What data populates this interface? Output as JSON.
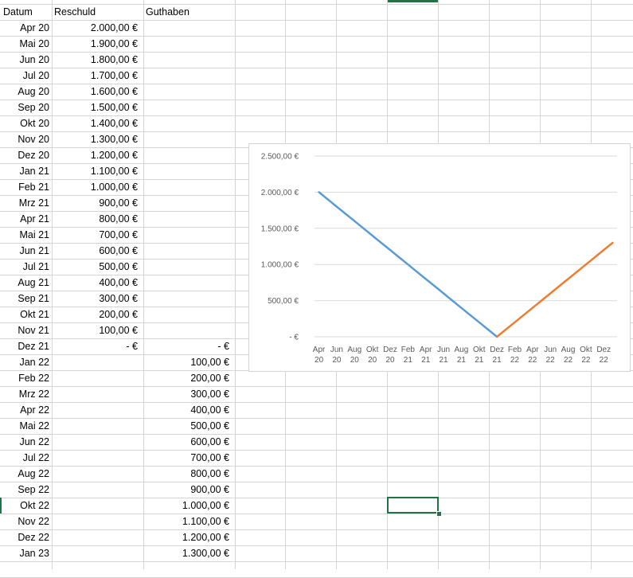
{
  "headers": {
    "datum": "Datum",
    "reschuld": "Reschuld",
    "guthaben": "Guthaben"
  },
  "rows": [
    {
      "datum": "Apr 20",
      "reschuld": "2.000,00 €",
      "guthaben": ""
    },
    {
      "datum": "Mai 20",
      "reschuld": "1.900,00 €",
      "guthaben": ""
    },
    {
      "datum": "Jun 20",
      "reschuld": "1.800,00 €",
      "guthaben": ""
    },
    {
      "datum": "Jul 20",
      "reschuld": "1.700,00 €",
      "guthaben": ""
    },
    {
      "datum": "Aug 20",
      "reschuld": "1.600,00 €",
      "guthaben": ""
    },
    {
      "datum": "Sep 20",
      "reschuld": "1.500,00 €",
      "guthaben": ""
    },
    {
      "datum": "Okt 20",
      "reschuld": "1.400,00 €",
      "guthaben": ""
    },
    {
      "datum": "Nov 20",
      "reschuld": "1.300,00 €",
      "guthaben": ""
    },
    {
      "datum": "Dez 20",
      "reschuld": "1.200,00 €",
      "guthaben": ""
    },
    {
      "datum": "Jan 21",
      "reschuld": "1.100,00 €",
      "guthaben": ""
    },
    {
      "datum": "Feb 21",
      "reschuld": "1.000,00 €",
      "guthaben": ""
    },
    {
      "datum": "Mrz 21",
      "reschuld": "900,00 €",
      "guthaben": ""
    },
    {
      "datum": "Apr 21",
      "reschuld": "800,00 €",
      "guthaben": ""
    },
    {
      "datum": "Mai 21",
      "reschuld": "700,00 €",
      "guthaben": ""
    },
    {
      "datum": "Jun 21",
      "reschuld": "600,00 €",
      "guthaben": ""
    },
    {
      "datum": "Jul 21",
      "reschuld": "500,00 €",
      "guthaben": ""
    },
    {
      "datum": "Aug 21",
      "reschuld": "400,00 €",
      "guthaben": ""
    },
    {
      "datum": "Sep 21",
      "reschuld": "300,00 €",
      "guthaben": ""
    },
    {
      "datum": "Okt 21",
      "reschuld": "200,00 €",
      "guthaben": ""
    },
    {
      "datum": "Nov 21",
      "reschuld": "100,00 €",
      "guthaben": ""
    },
    {
      "datum": "Dez 21",
      "reschuld": "-   €",
      "guthaben": "-   €"
    },
    {
      "datum": "Jan 22",
      "reschuld": "",
      "guthaben": "100,00 €"
    },
    {
      "datum": "Feb 22",
      "reschuld": "",
      "guthaben": "200,00 €"
    },
    {
      "datum": "Mrz 22",
      "reschuld": "",
      "guthaben": "300,00 €"
    },
    {
      "datum": "Apr 22",
      "reschuld": "",
      "guthaben": "400,00 €"
    },
    {
      "datum": "Mai 22",
      "reschuld": "",
      "guthaben": "500,00 €"
    },
    {
      "datum": "Jun 22",
      "reschuld": "",
      "guthaben": "600,00 €"
    },
    {
      "datum": "Jul 22",
      "reschuld": "",
      "guthaben": "700,00 €"
    },
    {
      "datum": "Aug 22",
      "reschuld": "",
      "guthaben": "800,00 €"
    },
    {
      "datum": "Sep 22",
      "reschuld": "",
      "guthaben": "900,00 €"
    },
    {
      "datum": "Okt 22",
      "reschuld": "",
      "guthaben": "1.000,00 €"
    },
    {
      "datum": "Nov 22",
      "reschuld": "",
      "guthaben": "1.100,00 €"
    },
    {
      "datum": "Dez 22",
      "reschuld": "",
      "guthaben": "1.200,00 €"
    },
    {
      "datum": "Jan 23",
      "reschuld": "",
      "guthaben": "1.300,00 €"
    }
  ],
  "chart_data": {
    "type": "line",
    "title": "",
    "xlabel": "",
    "ylabel": "",
    "ylim": [
      0,
      2500
    ],
    "y_tick_values": [
      0,
      500,
      1000,
      1500,
      2000,
      2500
    ],
    "y_tick_labels": [
      "-  €",
      "500,00 €",
      "1.000,00 €",
      "1.500,00 €",
      "2.000,00 €",
      "2.500,00 €"
    ],
    "x": [
      "Apr 20",
      "Mai 20",
      "Jun 20",
      "Jul 20",
      "Aug 20",
      "Sep 20",
      "Okt 20",
      "Nov 20",
      "Dez 20",
      "Jan 21",
      "Feb 21",
      "Mrz 21",
      "Apr 21",
      "Mai 21",
      "Jun 21",
      "Jul 21",
      "Aug 21",
      "Sep 21",
      "Okt 21",
      "Nov 21",
      "Dez 21",
      "Jan 22",
      "Feb 22",
      "Mrz 22",
      "Apr 22",
      "Mai 22",
      "Jun 22",
      "Jul 22",
      "Aug 22",
      "Sep 22",
      "Okt 22",
      "Nov 22",
      "Dez 22",
      "Jan 23"
    ],
    "x_tick_labels": [
      {
        "m": "Apr",
        "y": "20"
      },
      {
        "m": "Jun",
        "y": "20"
      },
      {
        "m": "Aug",
        "y": "20"
      },
      {
        "m": "Okt",
        "y": "20"
      },
      {
        "m": "Dez",
        "y": "20"
      },
      {
        "m": "Feb",
        "y": "21"
      },
      {
        "m": "Apr",
        "y": "21"
      },
      {
        "m": "Jun",
        "y": "21"
      },
      {
        "m": "Aug",
        "y": "21"
      },
      {
        "m": "Okt",
        "y": "21"
      },
      {
        "m": "Dez",
        "y": "21"
      },
      {
        "m": "Feb",
        "y": "22"
      },
      {
        "m": "Apr",
        "y": "22"
      },
      {
        "m": "Jun",
        "y": "22"
      },
      {
        "m": "Aug",
        "y": "22"
      },
      {
        "m": "Okt",
        "y": "22"
      },
      {
        "m": "Dez",
        "y": "22"
      }
    ],
    "grid": true,
    "legend": "none",
    "series": [
      {
        "color": "#5b9bd5",
        "values": [
          2000,
          1900,
          1800,
          1700,
          1600,
          1500,
          1400,
          1300,
          1200,
          1100,
          1000,
          900,
          800,
          700,
          600,
          500,
          400,
          300,
          200,
          100,
          0,
          null,
          null,
          null,
          null,
          null,
          null,
          null,
          null,
          null,
          null,
          null,
          null,
          null
        ]
      },
      {
        "color": "#ed7d31",
        "values": [
          null,
          null,
          null,
          null,
          null,
          null,
          null,
          null,
          null,
          null,
          null,
          null,
          null,
          null,
          null,
          null,
          null,
          null,
          null,
          null,
          0,
          100,
          200,
          300,
          400,
          500,
          600,
          700,
          800,
          900,
          1000,
          1100,
          1200,
          1300
        ]
      }
    ]
  },
  "colors": {
    "grid": "#d4d4d4",
    "selection": "#217346"
  }
}
